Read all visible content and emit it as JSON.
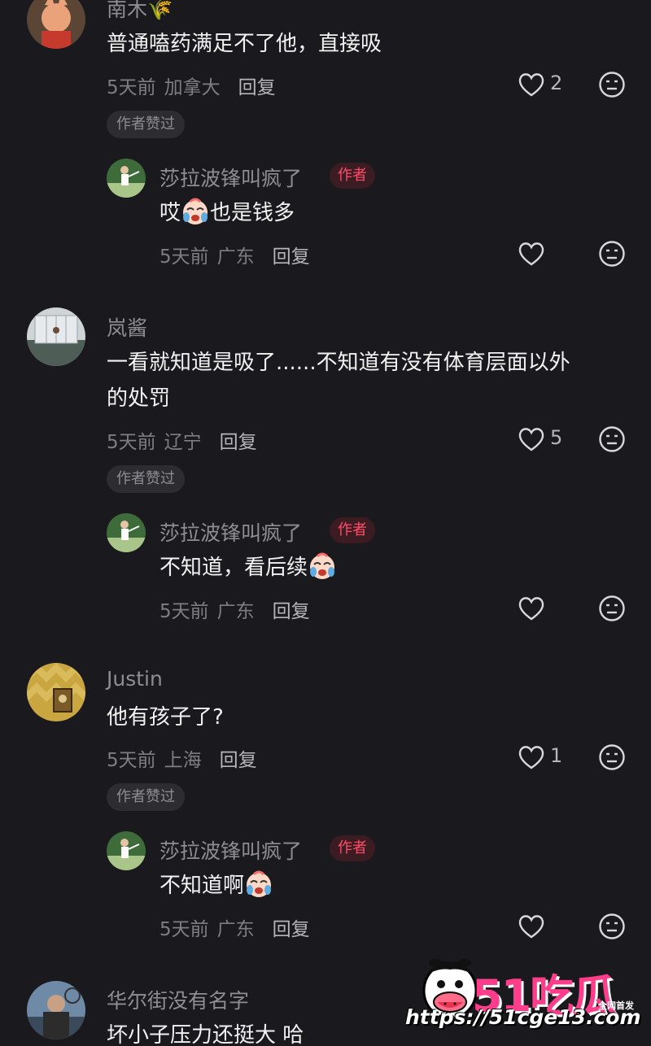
{
  "comments": [
    {
      "username": "南木🌾",
      "text": "普通嗑药满足不了他，直接吸",
      "time": "5天前",
      "location": "加拿大",
      "reply": "回复",
      "likes": "2",
      "author_liked": "作者赞过",
      "author_reply": {
        "username": "莎拉波锋叫疯了",
        "tag": "作者",
        "text_before": "哎",
        "text_after": "也是钱多",
        "time": "5天前",
        "location": "广东",
        "reply": "回复"
      }
    },
    {
      "username": "岚酱",
      "text_line1": "一看就知道是吸了......不知道有没有体育层面以外",
      "text_line2": "的处罚",
      "time": "5天前",
      "location": "辽宁",
      "reply": "回复",
      "likes": "5",
      "author_liked": "作者赞过",
      "author_reply": {
        "username": "莎拉波锋叫疯了",
        "tag": "作者",
        "text": "不知道，看后续",
        "time": "5天前",
        "location": "广东",
        "reply": "回复"
      }
    },
    {
      "username": "Justin",
      "text": "他有孩子了?",
      "time": "5天前",
      "location": "上海",
      "reply": "回复",
      "likes": "1",
      "author_liked": "作者赞过",
      "author_reply": {
        "username": "莎拉波锋叫疯了",
        "tag": "作者",
        "text": "不知道啊",
        "time": "5天前",
        "location": "广东",
        "reply": "回复"
      }
    },
    {
      "username": "华尔街没有名字",
      "text": "坏小子压力还挺大 哈"
    }
  ],
  "watermark": {
    "brand": "51吃瓜",
    "badge": "全网首发",
    "url": "https://51cge13.com"
  }
}
